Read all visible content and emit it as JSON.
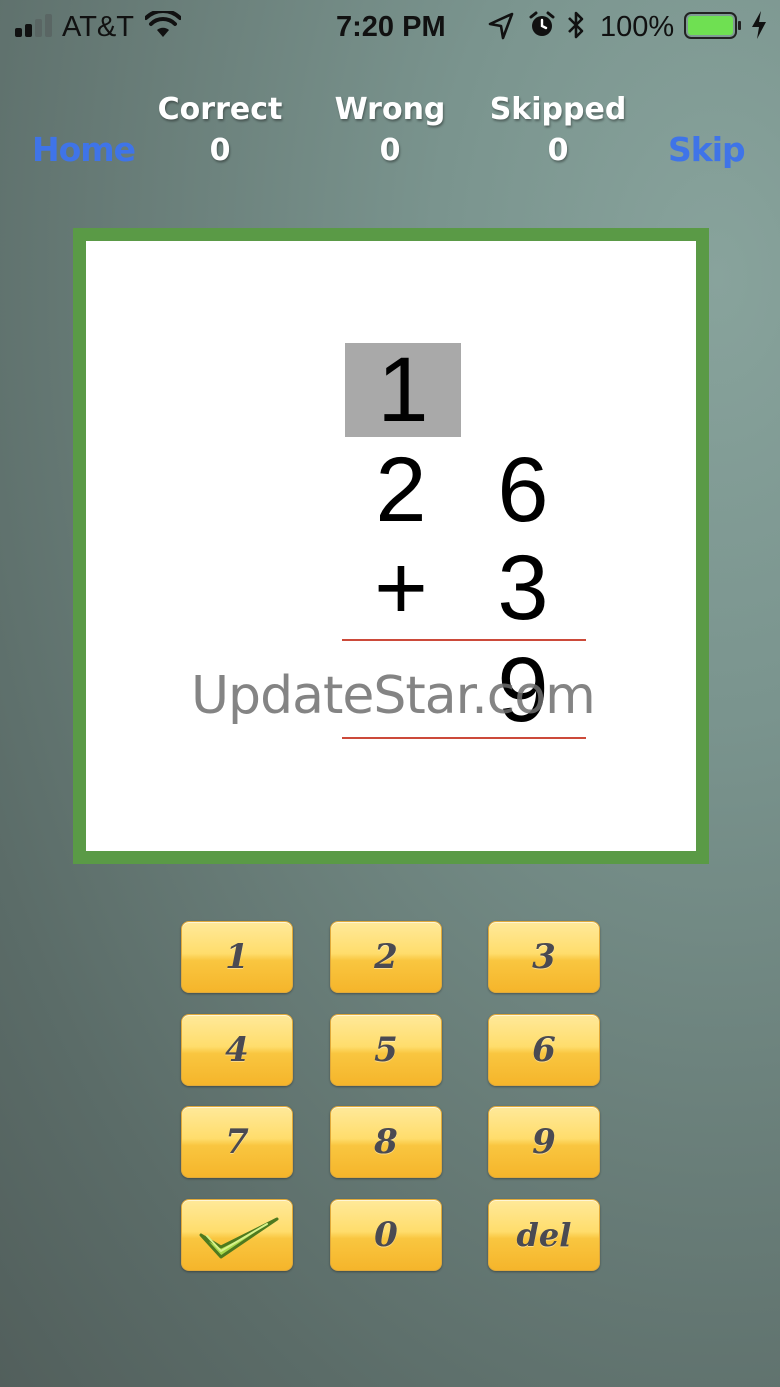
{
  "status_bar": {
    "carrier": "AT&T",
    "time": "7:20 PM",
    "battery_percent": "100%",
    "battery_level": 1.0,
    "signal_bars": 2,
    "icons": [
      "signal-icon",
      "wifi-icon",
      "location-arrow-icon",
      "alarm-icon",
      "bluetooth-icon",
      "battery-icon",
      "charging-bolt-icon"
    ]
  },
  "header": {
    "home_label": "Home",
    "skip_label": "Skip",
    "stats": [
      {
        "label": "Correct",
        "value": "0"
      },
      {
        "label": "Wrong",
        "value": "0"
      },
      {
        "label": "Skipped",
        "value": "0"
      }
    ],
    "link_color": "#3f74e8"
  },
  "problem": {
    "carry": "1",
    "top_row": [
      "2",
      "6"
    ],
    "operator": "+",
    "bottom_digit": "3",
    "answer": [
      "",
      "9"
    ],
    "carry_box_color": "#a9a9a9",
    "rule_color": "#cc4a3a",
    "border_color": "#5a9a46"
  },
  "watermark": "UpdateStar.com",
  "keypad": {
    "keys": [
      "1",
      "2",
      "3",
      "4",
      "5",
      "6",
      "7",
      "8",
      "9",
      "check-icon",
      "0",
      "del"
    ],
    "key_color": "#f9c640"
  }
}
